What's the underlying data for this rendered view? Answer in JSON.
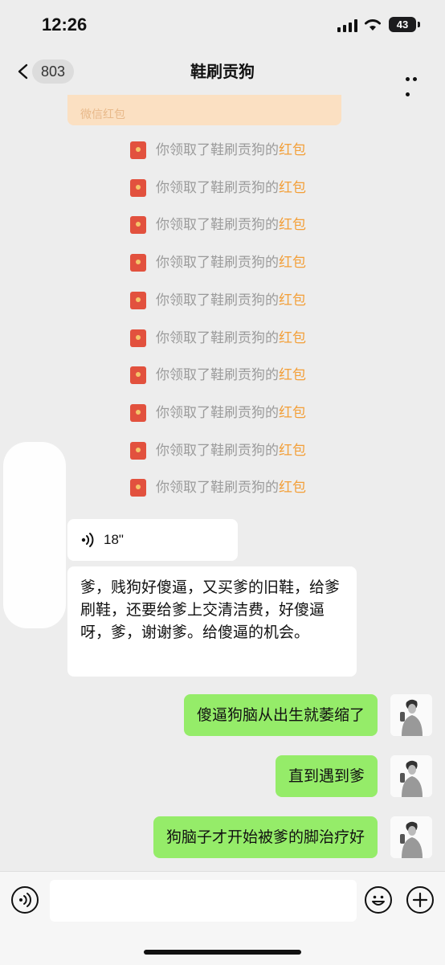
{
  "status_bar": {
    "time": "12:26",
    "battery": "43"
  },
  "nav": {
    "back_count": "803",
    "title": "鞋刷贡狗"
  },
  "red_packet_card": {
    "label": "微信红包"
  },
  "system_messages": [
    {
      "prefix": "你领取了鞋刷贡狗的",
      "highlight": "红包"
    },
    {
      "prefix": "你领取了鞋刷贡狗的",
      "highlight": "红包"
    },
    {
      "prefix": "你领取了鞋刷贡狗的",
      "highlight": "红包"
    },
    {
      "prefix": "你领取了鞋刷贡狗的",
      "highlight": "红包"
    },
    {
      "prefix": "你领取了鞋刷贡狗的",
      "highlight": "红包"
    },
    {
      "prefix": "你领取了鞋刷贡狗的",
      "highlight": "红包"
    },
    {
      "prefix": "你领取了鞋刷贡狗的",
      "highlight": "红包"
    },
    {
      "prefix": "你领取了鞋刷贡狗的",
      "highlight": "红包"
    },
    {
      "prefix": "你领取了鞋刷贡狗的",
      "highlight": "红包"
    },
    {
      "prefix": "你领取了鞋刷贡狗的",
      "highlight": "红包"
    }
  ],
  "voice_message": {
    "duration": "18\""
  },
  "incoming_text": "爹，贱狗好傻逼，又买爹的旧鞋，给爹刷鞋，还要给爹上交清洁费，好傻逼呀，爹，谢谢爹。给傻逼的机会。",
  "outgoing_messages": [
    {
      "text": "傻逼狗脑从出生就萎缩了"
    },
    {
      "text": "直到遇到爹"
    },
    {
      "text": "狗脑子才开始被爹的脚治疗好"
    }
  ],
  "colors": {
    "accent_green": "#95ec69",
    "red_packet_red": "#e2513e",
    "highlight_orange": "#f39f38"
  }
}
